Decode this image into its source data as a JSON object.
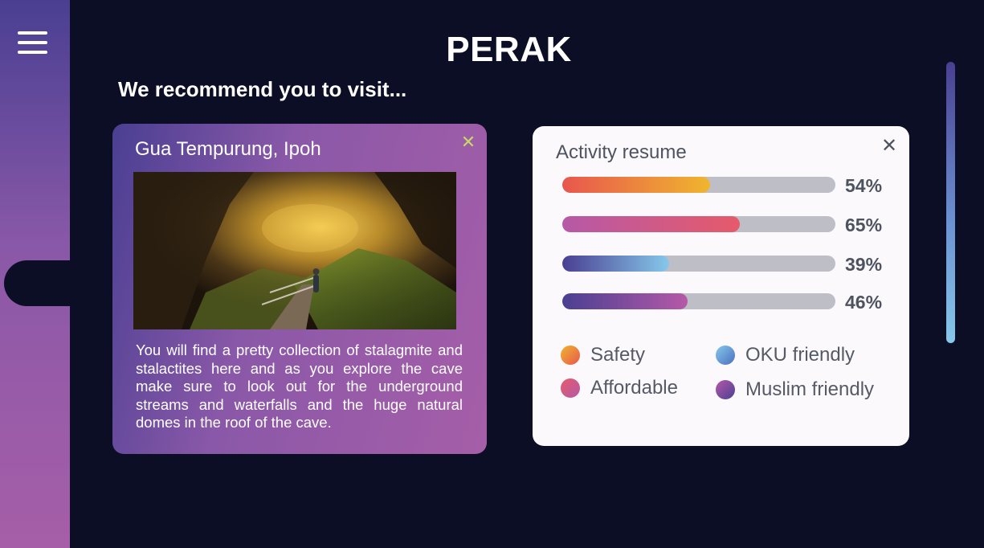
{
  "header": {
    "title": "PERAK",
    "subtitle": "We recommend you to visit..."
  },
  "sidebar": {
    "menu_icon": "hamburger-menu-icon"
  },
  "place_card": {
    "title": "Gua Tempurung, Ipoh",
    "close_icon": "close-icon",
    "description": "You will find a pretty collection of stalagmite and stalactites here and as you explore the cave make sure to look out for the underground streams and waterfalls and the huge natural domes in the roof of the cave."
  },
  "activity_card": {
    "title": "Activity resume",
    "close_icon": "close-icon",
    "bars": [
      {
        "category": "Safety",
        "percent": 54,
        "label": "54%",
        "color_start": "#e8564e",
        "color_end": "#f0b52e"
      },
      {
        "category": "Affordable",
        "percent": 65,
        "label": "65%",
        "color_start": "#b659a8",
        "color_end": "#e65a6a"
      },
      {
        "category": "OKU friendly",
        "percent": 39,
        "label": "39%",
        "color_start": "#4a3f92",
        "color_end": "#86c8ea"
      },
      {
        "category": "Muslim friendly",
        "percent": 46,
        "label": "46%",
        "color_start": "#4a3f92",
        "color_end": "#b659a8"
      }
    ],
    "legend": [
      {
        "label": "Safety",
        "color_start": "#f0b52e",
        "color_end": "#e8564e"
      },
      {
        "label": "OKU friendly",
        "color_start": "#86c8ea",
        "color_end": "#4a6fc0"
      },
      {
        "label": "Affordable",
        "color_start": "#e65a6a",
        "color_end": "#b659a8"
      },
      {
        "label": "Muslim friendly",
        "color_start": "#b659a8",
        "color_end": "#4a3f92"
      }
    ]
  },
  "colors": {
    "background": "#0b0e24",
    "accent_purple": "#a65ea8",
    "accent_indigo": "#4a3f92",
    "close_accent": "#c8d86a"
  }
}
